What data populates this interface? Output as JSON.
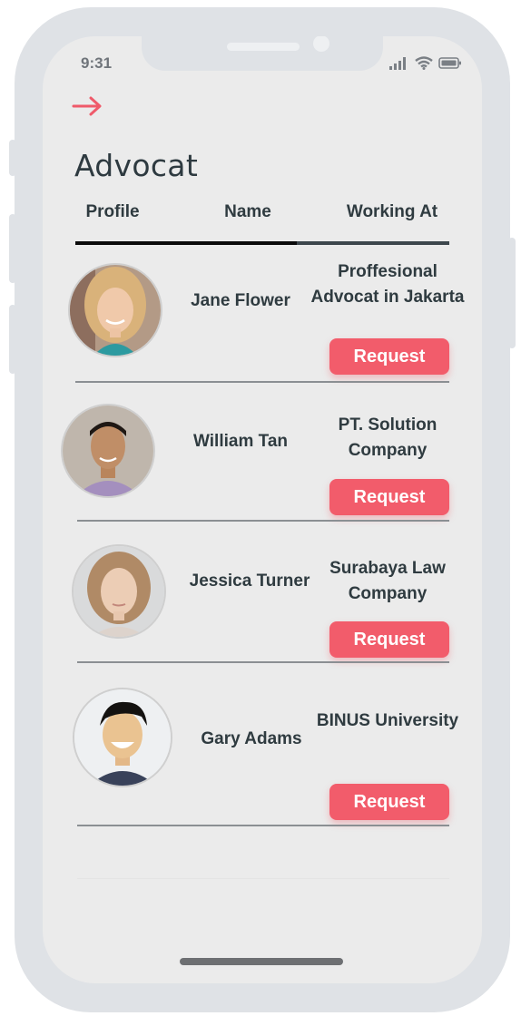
{
  "status_bar": {
    "time": "9:31"
  },
  "header": {
    "title": "Advocat"
  },
  "columns": {
    "profile": "Profile",
    "name": "Name",
    "working_at": "Working At"
  },
  "colors": {
    "accent": "#f25c6b",
    "text": "#2f3b40",
    "screen_bg": "#ebebeb",
    "frame": "#dfe2e6"
  },
  "advocates": [
    {
      "name": "Jane Flower",
      "working_at": "Proffesional Advocat in Jakarta",
      "action": "Request"
    },
    {
      "name": "William Tan",
      "working_at": "PT. Solution Company",
      "action": "Request"
    },
    {
      "name": "Jessica Turner",
      "working_at": "Surabaya Law Company",
      "action": "Request"
    },
    {
      "name": "Gary Adams",
      "working_at": "BINUS University",
      "action": "Request"
    }
  ]
}
